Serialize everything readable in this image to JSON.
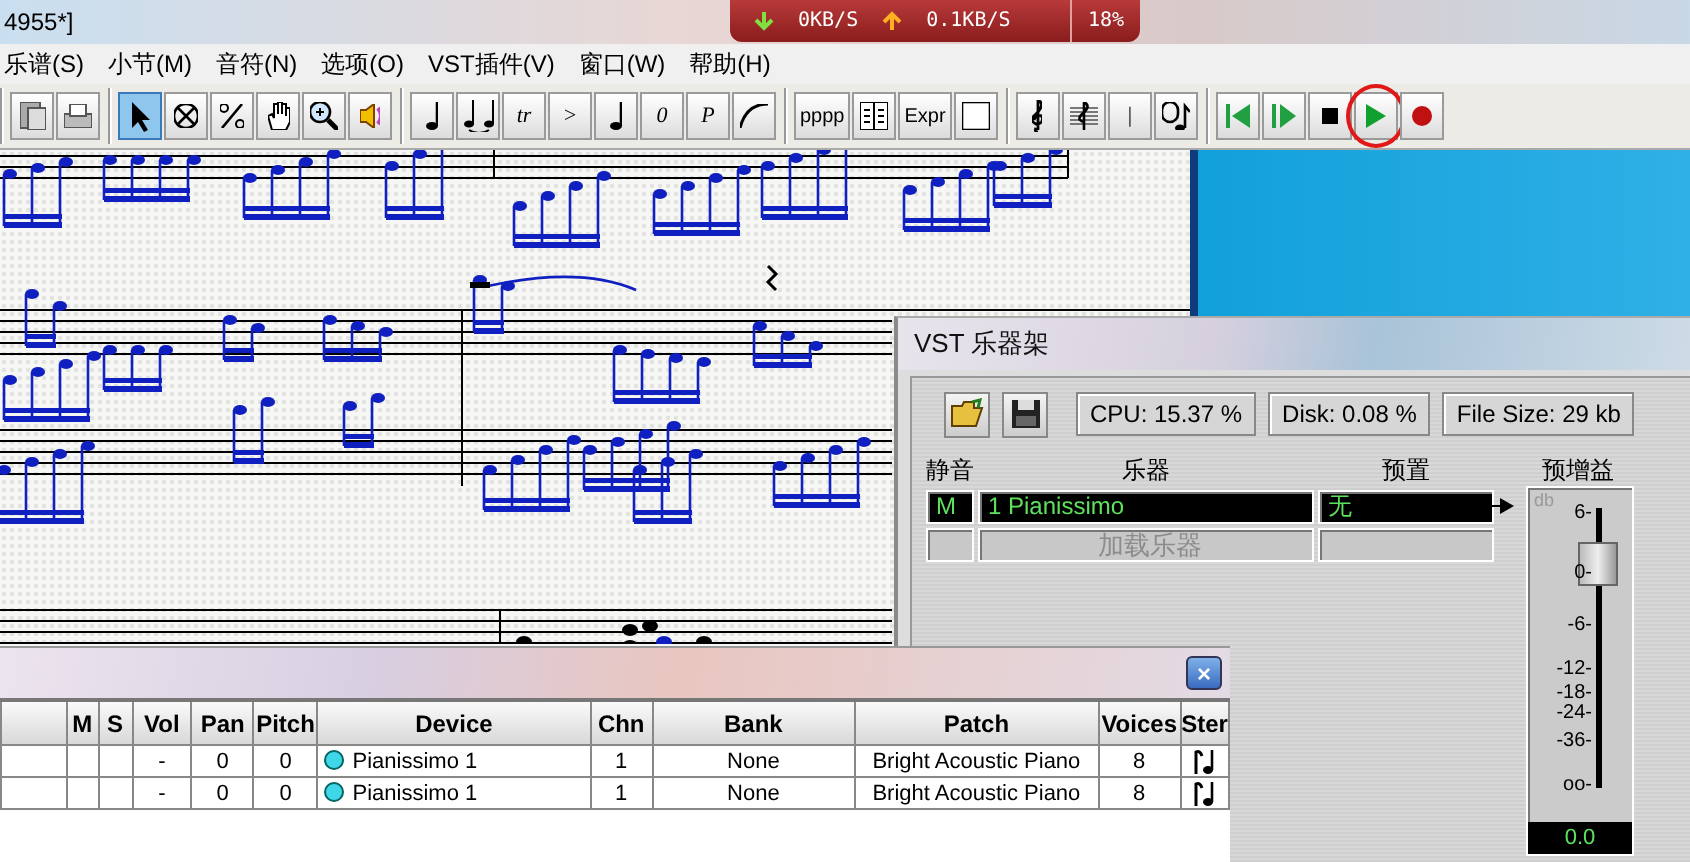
{
  "window": {
    "title": "4955*]"
  },
  "network_monitor": {
    "download": "0KB/S",
    "upload": "0.1KB/S",
    "usage": "18%"
  },
  "menu": [
    {
      "label": "乐谱(S)"
    },
    {
      "label": "小节(M)"
    },
    {
      "label": "音符(N)"
    },
    {
      "label": "选项(O)"
    },
    {
      "label": "VST插件(V)"
    },
    {
      "label": "窗口(W)"
    },
    {
      "label": "帮助(H)"
    }
  ],
  "toolbar": [
    [
      {
        "kind": "paste",
        "selected": false
      },
      {
        "kind": "print",
        "selected": false
      }
    ],
    [
      {
        "kind": "pointer",
        "selected": true
      },
      {
        "kind": "cancel",
        "selected": false
      },
      {
        "kind": "percent",
        "selected": false
      },
      {
        "kind": "hand",
        "selected": false
      },
      {
        "kind": "zoom",
        "selected": false
      },
      {
        "kind": "speaker",
        "selected": false
      }
    ],
    [
      {
        "kind": "note",
        "selected": false
      },
      {
        "kind": "tie",
        "selected": false
      },
      {
        "kind": "text",
        "label": "tr",
        "selected": false
      },
      {
        "kind": "text",
        "label": ">",
        "selected": false
      },
      {
        "kind": "note",
        "selected": false
      },
      {
        "kind": "text",
        "label": "0",
        "selected": false
      },
      {
        "kind": "text",
        "label": "P",
        "selected": false
      },
      {
        "kind": "slur",
        "selected": false
      }
    ],
    [
      {
        "kind": "text",
        "label": "pppp",
        "selected": false
      },
      {
        "kind": "lyrics",
        "selected": false
      },
      {
        "kind": "text",
        "label": "Expr",
        "selected": false
      },
      {
        "kind": "frame",
        "selected": false
      }
    ],
    [
      {
        "kind": "clef",
        "selected": false
      },
      {
        "kind": "staff",
        "selected": false
      },
      {
        "kind": "text",
        "label": "|",
        "selected": false
      },
      {
        "kind": "chord",
        "selected": false
      }
    ],
    [
      {
        "kind": "rewind",
        "selected": false
      },
      {
        "kind": "step",
        "selected": false
      },
      {
        "kind": "stop",
        "selected": false
      },
      {
        "kind": "play",
        "selected": false,
        "circled": true
      },
      {
        "kind": "record",
        "selected": false
      }
    ]
  ],
  "vst_rack": {
    "title": "VST 乐器架",
    "stats": [
      "CPU: 15.37 %",
      "Disk: 0.08 %",
      "File Size: 29 kb"
    ],
    "columns": [
      "静音",
      "乐器",
      "预置",
      "预增益"
    ],
    "slots": [
      {
        "mute": "M",
        "instrument": "1  Pianissimo",
        "preset": "无",
        "loaded": true
      },
      {
        "instrument": "加载乐器",
        "loaded": false
      }
    ],
    "fader": {
      "unit": "db",
      "scale": [
        "6-",
        "0-",
        "-6-",
        "-12-",
        "-18-",
        "-24-",
        "-36-",
        "oo-"
      ],
      "level": 0.8,
      "reading": "0.0"
    }
  },
  "mixer": {
    "close": "×",
    "columns": [
      "",
      "M",
      "S",
      "Vol",
      "Pan",
      "Pitch",
      "Device",
      "Chn",
      "Bank",
      "Patch",
      "Voices",
      "Ster"
    ],
    "rows": [
      {
        "vol": "-",
        "pan": "0",
        "pitch": "0",
        "device": "Pianissimo 1",
        "color": "#3fd6e8",
        "chn": "1",
        "bank": "None",
        "patch": "Bright Acoustic Piano",
        "voices": "8"
      },
      {
        "vol": "-",
        "pan": "0",
        "pitch": "0",
        "device": "Pianissimo 1",
        "color": "#3fd6e8",
        "chn": "1",
        "bank": "None",
        "patch": "Bright Acoustic Piano",
        "voices": "8"
      }
    ]
  }
}
